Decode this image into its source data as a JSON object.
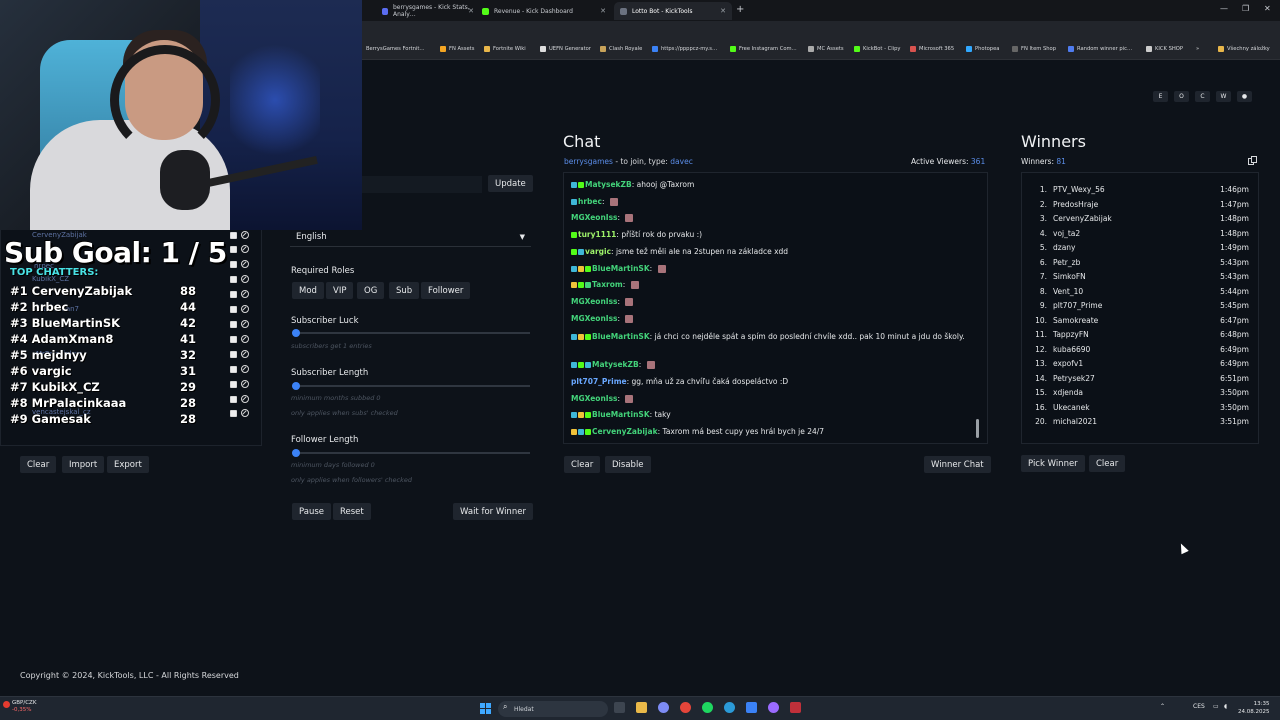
{
  "browser": {
    "tabs": [
      {
        "label": "berrysgames - Kick Stats, Analy…",
        "color": "#5a6cf0"
      },
      {
        "label": "Revenue - Kick Dashboard",
        "color": "#53fc18"
      },
      {
        "label": "Lotto Bot - KickTools",
        "color": "#6b7280"
      }
    ],
    "bookmarks": [
      "BerrysGames Fortnit…",
      "FN Assets",
      "Fortnite Wiki",
      "UEFN Generator",
      "Clash Royale",
      "https://ppppcz-my.s…",
      "Free Instagram Com…",
      "MC Assets",
      "KickBot - Clipy",
      "Microsoft 365",
      "Photopea",
      "FN Item Shop",
      "Random winner pic…",
      "KICK SHOP",
      "»",
      "Všechny záložky"
    ]
  },
  "overlay": {
    "sub_goal": "Sub Goal:  1 / 5",
    "top_chatters_label": "TOP CHATTERS:",
    "chatters": [
      {
        "rank": "#1",
        "name": "CervenyZabijak",
        "count": "88"
      },
      {
        "rank": "#2",
        "name": "hrbec",
        "count": "44"
      },
      {
        "rank": "#3",
        "name": "BlueMartinSK",
        "count": "42"
      },
      {
        "rank": "#4",
        "name": "AdamXman8",
        "count": "41"
      },
      {
        "rank": "#5",
        "name": "mejdnyy",
        "count": "32"
      },
      {
        "rank": "#6",
        "name": "vargic",
        "count": "31"
      },
      {
        "rank": "#7",
        "name": "KubikX_CZ",
        "count": "29"
      },
      {
        "rank": "#8",
        "name": "MrPalacinkaaa",
        "count": "28"
      },
      {
        "rank": "#9",
        "name": "Gamesak",
        "count": "28"
      }
    ],
    "ghost_names": [
      "CervenyZabijak",
      "hrbec",
      "KubikX_CZ",
      "AdamXman7",
      "MrPalacinkaa",
      "vencastejskal_cz"
    ]
  },
  "left_buttons": {
    "clear": "Clear",
    "import": "Import",
    "export": "Export"
  },
  "settings": {
    "update_label": "Update",
    "language": "English",
    "required_roles_label": "Required Roles",
    "roles": [
      "Mod",
      "VIP",
      "OG",
      "Sub",
      "Follower"
    ],
    "subscriber_luck_label": "Subscriber Luck",
    "subscriber_luck_hint": "subscribers get 1 entries",
    "subscriber_luck_value": 0,
    "subscriber_length_label": "Subscriber Length",
    "subscriber_length_hint1": "minimum months subbed 0",
    "subscriber_length_hint2": "only applies when subs' checked",
    "subscriber_length_value": 0,
    "follower_length_label": "Follower Length",
    "follower_length_hint1": "minimum days followed 0",
    "follower_length_hint2": "only applies when followers' checked",
    "follower_length_value": 0,
    "pause_label": "Pause",
    "reset_label": "Reset",
    "wait_label": "Wait for Winner"
  },
  "chat": {
    "title": "Chat",
    "channel": "berrysgames",
    "join_text": " - to join, type: ",
    "keyword": "davec",
    "viewers_label": "Active Viewers: ",
    "viewers": "361",
    "messages": [
      {
        "user": "MatysekZB",
        "text": "ahooj @Taxrom",
        "uc": "u",
        "badges": [
          "#3fb7d8",
          "#53fc18"
        ]
      },
      {
        "user": "hrbec",
        "text": "",
        "uc": "u",
        "badges": [
          "#3fb7d8"
        ],
        "emote": true
      },
      {
        "user": "MGXeonIss",
        "text": "",
        "uc": "u",
        "badges": [],
        "emote": true
      },
      {
        "user": "tury1111",
        "text": "příští rok do prvaku :)",
        "uc": "u3",
        "badges": [
          "#53fc18"
        ]
      },
      {
        "user": "vargic",
        "text": "jsme tež měli ale na 2stupen na základce xdd",
        "uc": "u3",
        "badges": [
          "#53fc18",
          "#3fb7d8"
        ]
      },
      {
        "user": "BlueMartinSK",
        "text": "",
        "uc": "u",
        "badges": [
          "#3fb7d8",
          "#f0c23a",
          "#53fc18"
        ],
        "emote": true
      },
      {
        "user": "Taxrom",
        "text": "",
        "uc": "u",
        "badges": [
          "#f0c23a",
          "#53fc18",
          "#43d37a"
        ],
        "emote": true
      },
      {
        "user": "MGXeonIss",
        "text": "",
        "uc": "u",
        "badges": [],
        "emote": true
      },
      {
        "user": "MGXeonIss",
        "text": "",
        "uc": "u",
        "badges": [],
        "emote": true
      },
      {
        "user": "BlueMartinSK",
        "text": "já chci co nejděle spát a spím do poslední chvíle xdd.. pak 10 minut a jdu do školy.",
        "uc": "u",
        "badges": [
          "#3fb7d8",
          "#f0c23a",
          "#53fc18"
        ],
        "wrap": true
      },
      {
        "user": "MatysekZB",
        "text": "",
        "uc": "u",
        "badges": [
          "#3fb7d8",
          "#53fc18",
          "#3fb7d8"
        ],
        "emote": true
      },
      {
        "user": "plt707_Prime",
        "text": "gg, mňa už za chvíľu čaká dospeláctvo :D",
        "uc": "u4",
        "badges": []
      },
      {
        "user": "MGXeonIss",
        "text": "",
        "uc": "u",
        "badges": [],
        "emote": true
      },
      {
        "user": "BlueMartinSK",
        "text": "taky",
        "uc": "u",
        "badges": [
          "#3fb7d8",
          "#f0c23a",
          "#53fc18"
        ]
      },
      {
        "user": "CervenyZabijak",
        "text": "Taxrom má best cupy yes hrál bych je 24/7",
        "uc": "u",
        "badges": [
          "#f0c23a",
          "#3fb7d8",
          "#53fc18"
        ]
      }
    ],
    "clear_label": "Clear",
    "disable_label": "Disable",
    "winner_chat_label": "Winner Chat"
  },
  "winners": {
    "title": "Winners",
    "count_label": "Winners: ",
    "count": "81",
    "list": [
      {
        "n": "1.",
        "name": "PTV_Wexy_56",
        "time": "1:46pm"
      },
      {
        "n": "2.",
        "name": "PredosHraje",
        "time": "1:47pm"
      },
      {
        "n": "3.",
        "name": "CervenyZabijak",
        "time": "1:48pm"
      },
      {
        "n": "4.",
        "name": "voj_ta2",
        "time": "1:48pm"
      },
      {
        "n": "5.",
        "name": "dzany",
        "time": "1:49pm"
      },
      {
        "n": "6.",
        "name": "Petr_zb",
        "time": "5:43pm"
      },
      {
        "n": "7.",
        "name": "SimkoFN",
        "time": "5:43pm"
      },
      {
        "n": "8.",
        "name": "Vent_10",
        "time": "5:44pm"
      },
      {
        "n": "9.",
        "name": "plt707_Prime",
        "time": "5:45pm"
      },
      {
        "n": "10.",
        "name": "Samokreate",
        "time": "6:47pm"
      },
      {
        "n": "11.",
        "name": "TappzyFN",
        "time": "6:48pm"
      },
      {
        "n": "12.",
        "name": "kuba6690",
        "time": "6:49pm"
      },
      {
        "n": "13.",
        "name": "expofv1",
        "time": "6:49pm"
      },
      {
        "n": "14.",
        "name": "Petrysek27",
        "time": "6:51pm"
      },
      {
        "n": "15.",
        "name": "xdjenda",
        "time": "3:50pm"
      },
      {
        "n": "16.",
        "name": "Ukecanek",
        "time": "3:50pm"
      },
      {
        "n": "20.",
        "name": "michal2021",
        "time": "3:51pm"
      }
    ],
    "pick_label": "Pick Winner",
    "clear_label": "Clear"
  },
  "top_icons": [
    "E",
    "O",
    "C",
    "W",
    "●"
  ],
  "footer": {
    "copyright": "Copyright © 2024, KickTools, LLC - All Rights Reserved"
  },
  "taskbar": {
    "stock_name": "GBP/CZK",
    "stock_change": "-0,35%",
    "search_placeholder": "Hledat",
    "lang": "CES",
    "time": "13:35",
    "date": "24.08.2025"
  }
}
